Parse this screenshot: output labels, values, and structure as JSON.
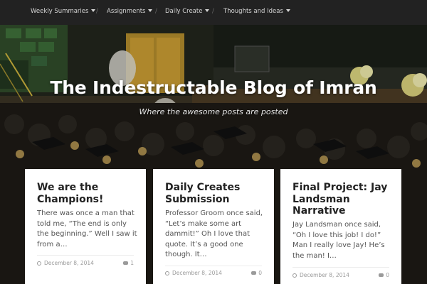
{
  "nav": {
    "items": [
      {
        "label": "Weekly Summaries"
      },
      {
        "label": "Assignments"
      },
      {
        "label": "Daily Create"
      },
      {
        "label": "Thoughts and Ideas"
      }
    ],
    "separator": "/"
  },
  "hero": {
    "title": "The Indestructable Blog of Imran",
    "tagline": "Where the awesome posts are posted"
  },
  "posts": [
    {
      "title": "We are the Champions!",
      "excerpt": "There was once a man that told me, “The end is only the beginning.” Well I saw it from a…",
      "date": "December 8, 2014",
      "comments": "1"
    },
    {
      "title": "Daily Creates Submission",
      "excerpt": "Professor Groom once said, “Let’s make some art dammit!” Oh I love that quote. It’s a good one though. It…",
      "date": "December 8, 2014",
      "comments": "0"
    },
    {
      "title": "Final Project: Jay Landsman Narrative",
      "excerpt": "Jay Landsman once said, “Oh I love this job! I do!” Man I really love Jay! He’s the man! I…",
      "date": "December 8, 2014",
      "comments": "0"
    }
  ],
  "colors": {
    "navbar": "#222222",
    "card_bg": "#ffffff",
    "title_text": "#ffffff"
  },
  "icons": [
    "chevron-down-icon",
    "clock-icon",
    "comment-icon"
  ]
}
